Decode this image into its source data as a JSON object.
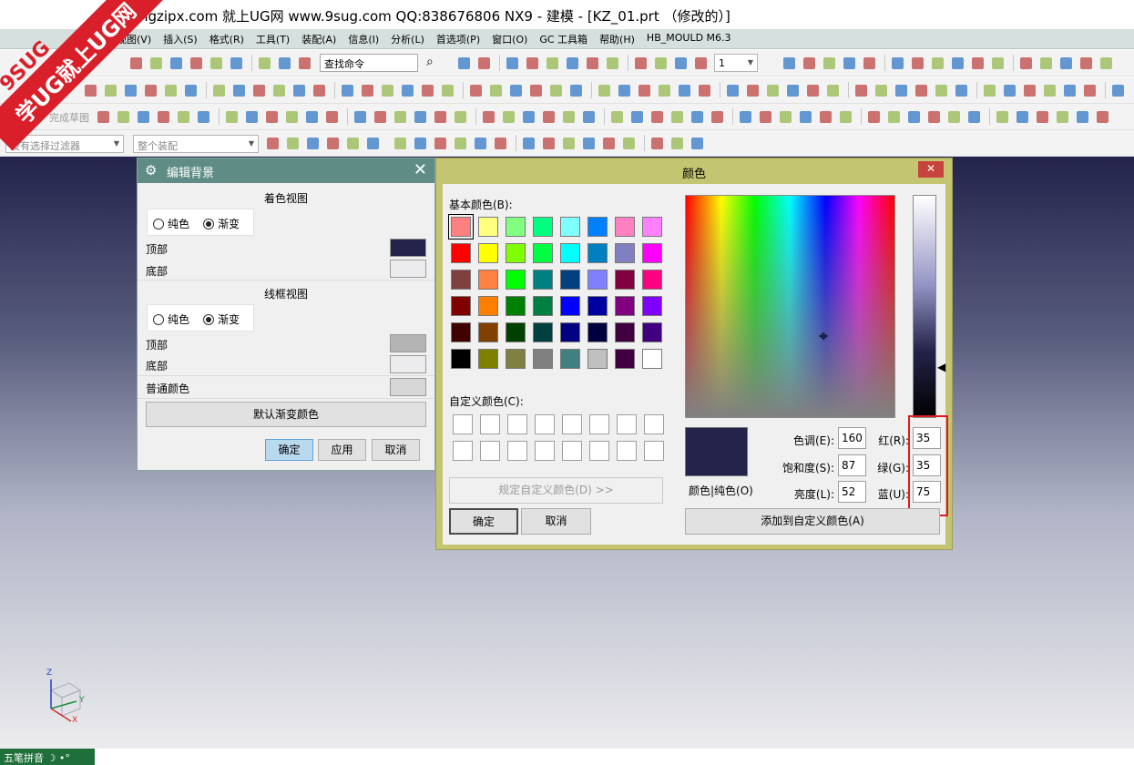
{
  "window": {
    "title": "w.kongzipx.com 就上UG网 www.9sug.com QQ:838676806 NX9 - 建模 - [KZ_01.prt （修改的）]"
  },
  "watermark": {
    "line1": "9SUG",
    "line2": "学UG就上UG网"
  },
  "menubar": {
    "items": [
      "视图(V)",
      "插入(S)",
      "格式(R)",
      "工具(T)",
      "装配(A)",
      "信息(I)",
      "分析(L)",
      "首选项(P)",
      "窗口(O)",
      "GC 工具箱",
      "帮助(H)",
      "HB_MOULD M6.3"
    ]
  },
  "toolbar": {
    "search_command": "查找命令",
    "layer_value": "1",
    "finish_sketch": "完成草图",
    "selection_filter": "没有选择过滤器",
    "assembly_scope": "整个装配"
  },
  "edit_background": {
    "title": "编辑背景",
    "shaded_view_heading": "着色视图",
    "wireframe_view_heading": "线框视图",
    "plain_label": "纯色",
    "gradient_label": "渐变",
    "top_label": "顶部",
    "bottom_label": "底部",
    "plain_color_label": "普通颜色",
    "default_gradient_button": "默认渐变颜色",
    "ok_button": "确定",
    "apply_button": "应用",
    "cancel_button": "取消",
    "colors": {
      "shaded_top": "#23234b",
      "shaded_bottom": "#ececee",
      "wire_top": "#b4b4b4",
      "wire_bottom": "#ececee",
      "plain": "#d7d7d7"
    }
  },
  "color_dialog": {
    "title": "颜色",
    "close_label": "✕",
    "basic_colors_label": "基本颜色(B):",
    "custom_colors_label": "自定义颜色(C):",
    "define_custom_button": "规定自定义颜色(D) >>",
    "ok_button": "确定",
    "cancel_button": "取消",
    "color_solid_label": "颜色|纯色(O)",
    "add_custom_button": "添加到自定义颜色(A)",
    "hue_label": "色调(E):",
    "hue_value": "160",
    "sat_label": "饱和度(S):",
    "sat_value": "87",
    "lum_label": "亮度(L):",
    "lum_value": "52",
    "red_label": "红(R):",
    "red_value": "35",
    "green_label": "绿(G):",
    "green_value": "35",
    "blue_label": "蓝(U):",
    "blue_value": "75",
    "current_color": "#23234b",
    "basic_colors": [
      "#ff8080",
      "#ffff80",
      "#80ff80",
      "#00ff80",
      "#80ffff",
      "#0080ff",
      "#ff80c0",
      "#ff80ff",
      "#ff0000",
      "#ffff00",
      "#80ff00",
      "#00ff40",
      "#00ffff",
      "#0080c0",
      "#8080c0",
      "#ff00ff",
      "#804040",
      "#ff8040",
      "#00ff00",
      "#008080",
      "#004080",
      "#8080ff",
      "#800040",
      "#ff0080",
      "#800000",
      "#ff8000",
      "#008000",
      "#008040",
      "#0000ff",
      "#0000a0",
      "#800080",
      "#8000ff",
      "#400000",
      "#804000",
      "#004000",
      "#004040",
      "#000080",
      "#000040",
      "#400040",
      "#400080",
      "#000000",
      "#808000",
      "#808040",
      "#808080",
      "#408080",
      "#c0c0c0",
      "#400040",
      "#ffffff"
    ]
  },
  "status": {
    "ime": "五笔拼音 ☽ •°"
  },
  "triad": {
    "z": "Z",
    "y": "Y",
    "x": "X"
  }
}
